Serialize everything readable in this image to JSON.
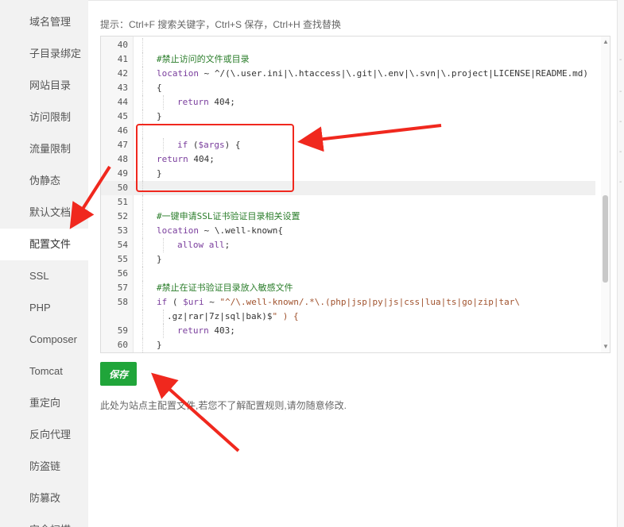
{
  "sidebar": {
    "items": [
      {
        "label": "域名管理"
      },
      {
        "label": "子目录绑定"
      },
      {
        "label": "网站目录"
      },
      {
        "label": "访问限制"
      },
      {
        "label": "流量限制"
      },
      {
        "label": "伪静态"
      },
      {
        "label": "默认文档"
      },
      {
        "label": "配置文件",
        "active": true
      },
      {
        "label": "SSL"
      },
      {
        "label": "PHP"
      },
      {
        "label": "Composer"
      },
      {
        "label": "Tomcat"
      },
      {
        "label": "重定向"
      },
      {
        "label": "反向代理"
      },
      {
        "label": "防盗链"
      },
      {
        "label": "防篡改"
      },
      {
        "label": "安全扫描"
      }
    ]
  },
  "hint": "提示：Ctrl+F 搜索关键字，Ctrl+S 保存，Ctrl+H 查找替换",
  "editor": {
    "lines": [
      {
        "num": "40",
        "text": ""
      },
      {
        "num": "41",
        "text": "#禁止访问的文件或目录",
        "type": "comment"
      },
      {
        "num": "42",
        "text": "location ~ ^/(\\.user.ini|\\.htaccess|\\.git|\\.env|\\.svn|\\.project|LICENSE|README.md)"
      },
      {
        "num": "43",
        "text": "{"
      },
      {
        "num": "44",
        "text": "return 404;",
        "indent": 1
      },
      {
        "num": "45",
        "text": "}"
      },
      {
        "num": "46",
        "text": ""
      },
      {
        "num": "47",
        "text": "if ($args) {",
        "indent": 1
      },
      {
        "num": "48",
        "text": "return 404;"
      },
      {
        "num": "49",
        "text": "}"
      },
      {
        "num": "50",
        "text": "",
        "active": true
      },
      {
        "num": "51",
        "text": ""
      },
      {
        "num": "52",
        "text": "#一键申请SSL证书验证目录相关设置",
        "type": "comment"
      },
      {
        "num": "53",
        "text": "location ~ \\.well-known{"
      },
      {
        "num": "54",
        "text": "allow all;",
        "indent": 1
      },
      {
        "num": "55",
        "text": "}"
      },
      {
        "num": "56",
        "text": ""
      },
      {
        "num": "57",
        "text": "#禁止在证书验证目录放入敏感文件",
        "type": "comment"
      },
      {
        "num": "58",
        "text": "if ( $uri ~ \"^/\\.well-known/.*\\.(php|jsp|py|js|css|lua|ts|go|zip|tar\\"
      },
      {
        "num": "",
        "text": ".gz|rar|7z|sql|bak)$\" ) {",
        "indent": 0.5
      },
      {
        "num": "59",
        "text": "return 403;",
        "indent": 1
      },
      {
        "num": "60",
        "text": "}"
      }
    ]
  },
  "save_label": "保存",
  "note": "此处为站点主配置文件,若您不了解配置规则,请勿随意修改.",
  "colors": {
    "accent": "#20a53a",
    "annotation": "#f0281e"
  }
}
